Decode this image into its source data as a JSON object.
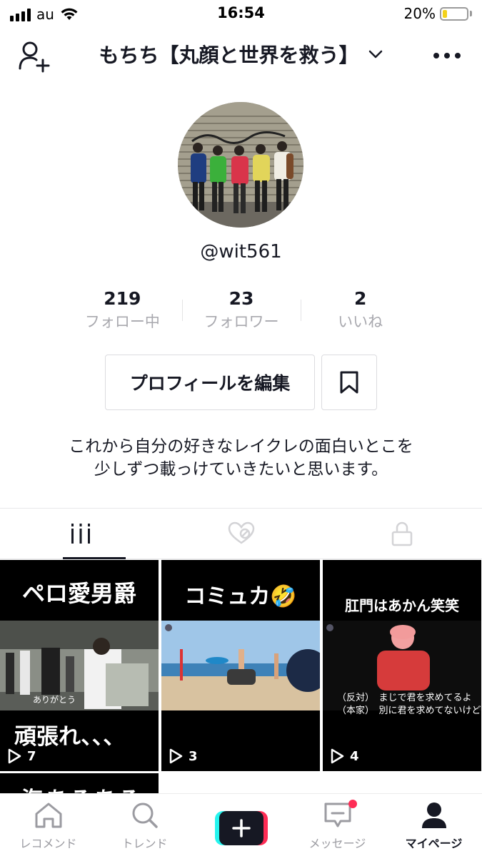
{
  "status_bar": {
    "carrier": "au",
    "time": "16:54",
    "battery_percent": "20%",
    "battery_level": 0.2,
    "battery_color": "#f3d21b"
  },
  "header": {
    "title": "もちち【丸顔と世界を救う】",
    "icons": [
      "add-user-icon",
      "chevron-down-icon",
      "more-icon"
    ]
  },
  "profile": {
    "username": "@wit561",
    "stats": [
      {
        "value": "219",
        "label": "フォロー中"
      },
      {
        "value": "23",
        "label": "フォロワー"
      },
      {
        "value": "2",
        "label": "いいね"
      }
    ],
    "edit_button": "プロフィールを編集",
    "bio_line1": "これから自分の好きなレイクレの面白いとこを",
    "bio_line2": "少しずつ載っけていきたいと思います。"
  },
  "tabs": [
    {
      "icon": "grid-icon",
      "active": true
    },
    {
      "icon": "liked-icon",
      "active": false
    },
    {
      "icon": "lock-icon",
      "active": false
    }
  ],
  "videos": [
    {
      "title": "ペロ愛男爵",
      "caption": "頑張れ、、、",
      "overlay": "ありがとう",
      "plays": "7"
    },
    {
      "title": "コミュカ🤣",
      "caption": "",
      "plays": "3"
    },
    {
      "title": "肛門はあかん笑笑",
      "sub1": "（反対）　まじで君を求めてるよ",
      "sub2": "（本家）　別に君を求めてないけど",
      "plays": "4"
    },
    {
      "title": "海あるある"
    }
  ],
  "bottom_nav": [
    {
      "label": "レコメンド",
      "icon": "home-icon"
    },
    {
      "label": "トレンド",
      "icon": "search-icon"
    },
    {
      "label": "",
      "icon": "plus-icon"
    },
    {
      "label": "メッセージ",
      "icon": "inbox-icon"
    },
    {
      "label": "マイページ",
      "icon": "profile-icon",
      "active": true
    }
  ],
  "colors": {
    "accent": "#fe2c55",
    "cyan": "#25f4ee",
    "text": "#161823",
    "muted": "#a8a8ae"
  }
}
